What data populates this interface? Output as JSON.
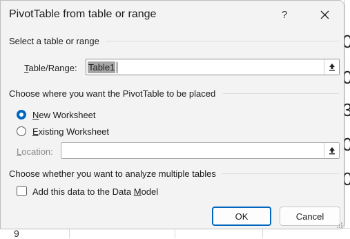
{
  "dialog": {
    "title": "PivotTable from table or range",
    "help_label": "?",
    "section_select": "Select a table or range",
    "table_range": {
      "label_u": "T",
      "label_rest": "able/Range:",
      "value": "Table1"
    },
    "section_placement": "Choose where you want the PivotTable to be placed",
    "new_worksheet": {
      "label_u": "N",
      "label_rest": "ew Worksheet",
      "selected": true
    },
    "existing_worksheet": {
      "label_u": "E",
      "label_rest": "xisting Worksheet",
      "selected": false
    },
    "location": {
      "label_u": "L",
      "label_rest": "ocation:",
      "value": ""
    },
    "section_multiple": "Choose whether you want to analyze multiple tables",
    "data_model": {
      "label_pre": "Add this data to the Data ",
      "label_u": "M",
      "label_rest": "odel",
      "checked": false
    },
    "ok_label": "OK",
    "cancel_label": "Cancel"
  },
  "background_sheet": {
    "glyphs": [
      "0",
      "0",
      "3",
      "0",
      "0"
    ],
    "bottom_glyph": "9"
  },
  "colors": {
    "accent": "#0067c0",
    "dialog_bg": "#f3f3f3",
    "selection": "#a6a6a6"
  }
}
